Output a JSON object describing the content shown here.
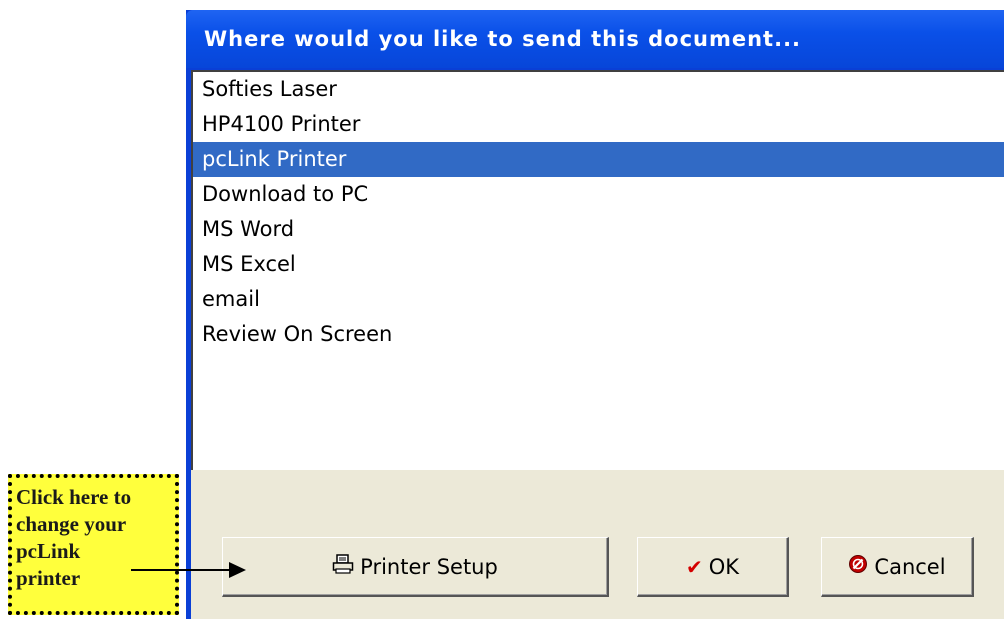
{
  "dialog": {
    "title": "Where would you like to send this document...",
    "destinations": [
      {
        "label": "Softies Laser",
        "selected": false
      },
      {
        "label": "HP4100 Printer",
        "selected": false
      },
      {
        "label": "pcLink Printer",
        "selected": true
      },
      {
        "label": "Download to PC",
        "selected": false
      },
      {
        "label": "MS Word",
        "selected": false
      },
      {
        "label": "MS Excel",
        "selected": false
      },
      {
        "label": "email",
        "selected": false
      },
      {
        "label": "Review On Screen",
        "selected": false
      }
    ],
    "buttons": {
      "printer_setup": {
        "label": "Printer Setup",
        "icon": "printer-icon"
      },
      "ok": {
        "label": "OK",
        "icon": "checkmark-icon"
      },
      "cancel": {
        "label": "Cancel",
        "icon": "cancel-icon"
      }
    }
  },
  "callout": {
    "lines": [
      "Click here to",
      "change your",
      "pcLink",
      "printer"
    ]
  },
  "colors": {
    "title_bar": "#0a50e8",
    "selection": "#316ac5",
    "button_face": "#ece9d8",
    "callout_bg": "#ffff3c"
  }
}
